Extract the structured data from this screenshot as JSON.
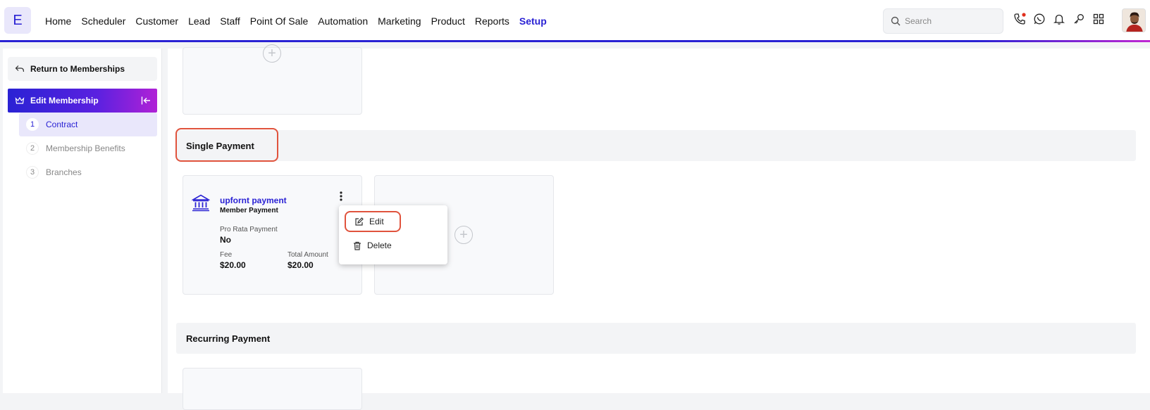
{
  "logo": {
    "letter": "E"
  },
  "nav": {
    "items": [
      "Home",
      "Scheduler",
      "Customer",
      "Lead",
      "Staff",
      "Point Of Sale",
      "Automation",
      "Marketing",
      "Product",
      "Reports",
      "Setup"
    ],
    "active": "Setup"
  },
  "search": {
    "placeholder": "Search"
  },
  "header_icons": [
    "phone-icon",
    "whatsapp-icon",
    "bell-icon",
    "key-icon",
    "apps-grid-icon"
  ],
  "sidebar": {
    "return_label": "Return to Memberships",
    "edit_label": "Edit Membership",
    "steps": [
      {
        "num": "1",
        "label": "Contract"
      },
      {
        "num": "2",
        "label": "Membership Benefits"
      },
      {
        "num": "3",
        "label": "Branches"
      }
    ]
  },
  "sections": {
    "single": "Single Payment",
    "recurring": "Recurring Payment"
  },
  "payment_card": {
    "title": "upfornt payment",
    "subtitle": "Member Payment",
    "pro_rata_label": "Pro Rata Payment",
    "pro_rata_value": "No",
    "fee_label": "Fee",
    "fee_value": "$20.00",
    "total_label": "Total Amount",
    "total_value": "$20.00"
  },
  "context_menu": {
    "edit": "Edit",
    "delete": "Delete"
  },
  "colors": {
    "accent": "#2a22d4",
    "highlight": "#e0533d"
  }
}
